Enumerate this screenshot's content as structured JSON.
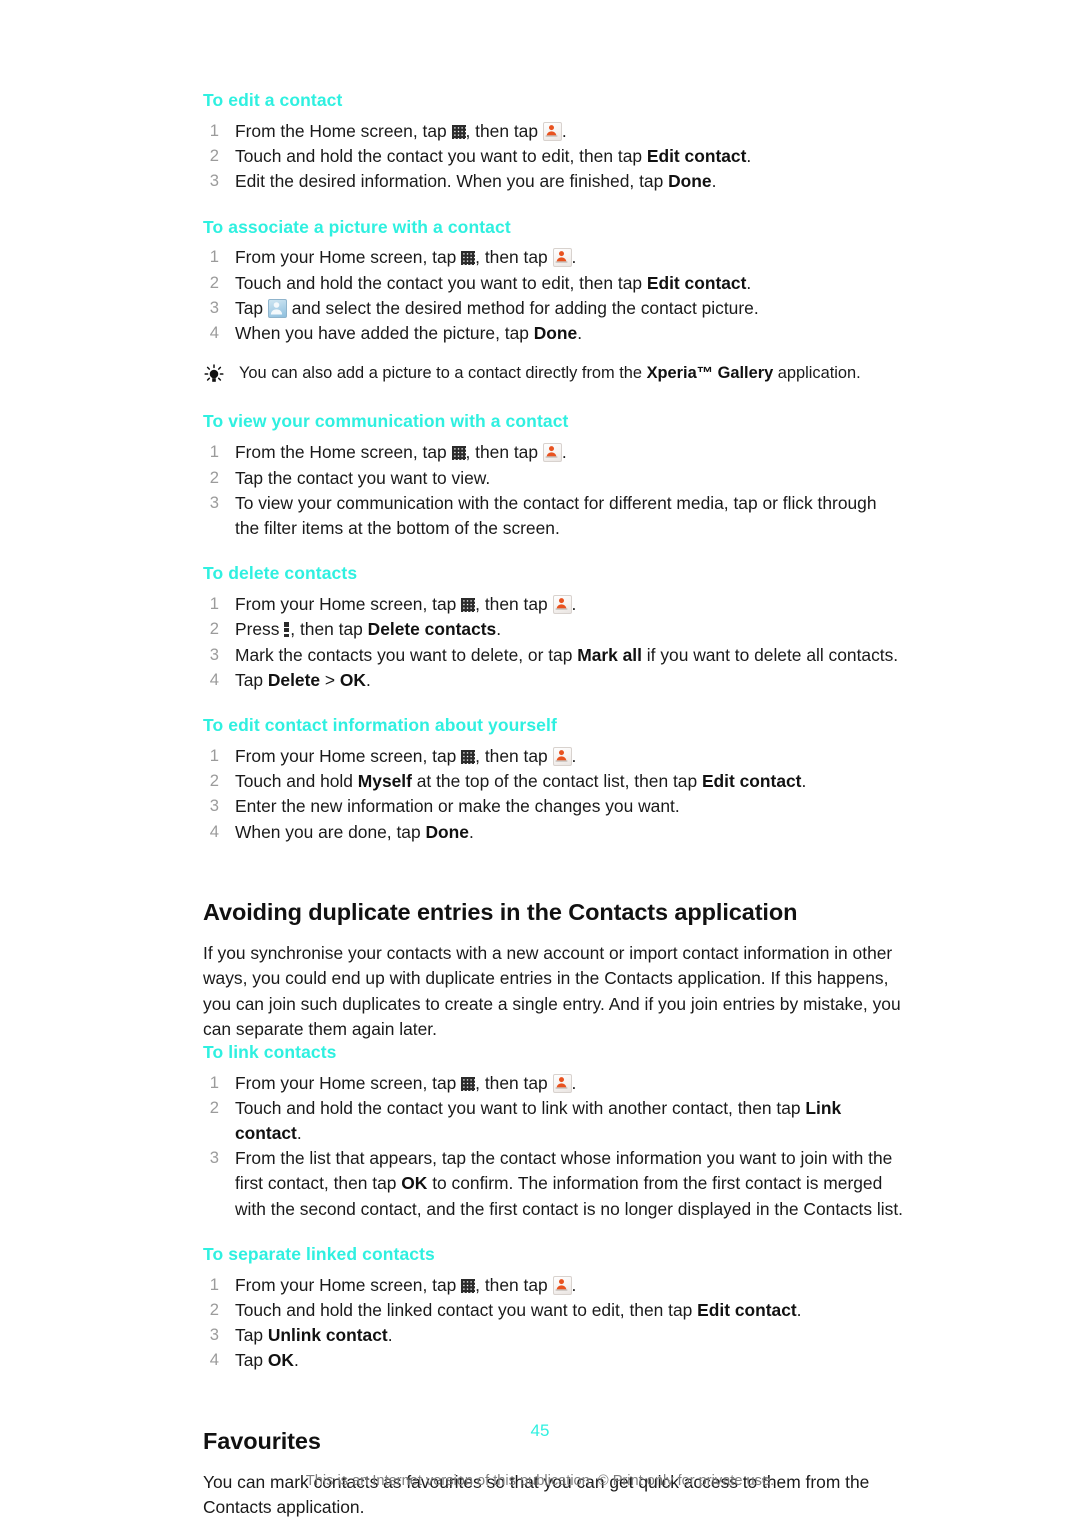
{
  "document": {
    "page_number": "45",
    "footer_note": "This is an Internet version of this publication. © Print only for private use.",
    "heading_color": "#2ff0e0",
    "text_color": "#1a1a1a",
    "number_color": "#9b9b9b"
  },
  "procedures": [
    {
      "id": "edit-a-contact",
      "heading": "To edit a contact",
      "steps": [
        {
          "num": "1",
          "parts": [
            {
              "t": "text",
              "v": "From the Home screen, tap "
            },
            {
              "t": "icon",
              "v": "app-grid-icon"
            },
            {
              "t": "text",
              "v": ", then tap "
            },
            {
              "t": "icon",
              "v": "contacts-icon"
            },
            {
              "t": "text",
              "v": "."
            }
          ]
        },
        {
          "num": "2",
          "parts": [
            {
              "t": "text",
              "v": "Touch and hold the contact you want to edit, then tap "
            },
            {
              "t": "bold",
              "v": "Edit contact"
            },
            {
              "t": "text",
              "v": "."
            }
          ]
        },
        {
          "num": "3",
          "parts": [
            {
              "t": "text",
              "v": "Edit the desired information. When you are finished, tap "
            },
            {
              "t": "bold",
              "v": "Done"
            },
            {
              "t": "text",
              "v": "."
            }
          ]
        }
      ]
    },
    {
      "id": "associate-a-picture-with-a-contact",
      "heading": "To associate a picture with a contact",
      "steps": [
        {
          "num": "1",
          "parts": [
            {
              "t": "text",
              "v": "From your Home screen, tap "
            },
            {
              "t": "icon",
              "v": "app-grid-icon"
            },
            {
              "t": "text",
              "v": ", then tap "
            },
            {
              "t": "icon",
              "v": "contacts-icon"
            },
            {
              "t": "text",
              "v": "."
            }
          ]
        },
        {
          "num": "2",
          "parts": [
            {
              "t": "text",
              "v": "Touch and hold the contact you want to edit, then tap "
            },
            {
              "t": "bold",
              "v": "Edit contact"
            },
            {
              "t": "text",
              "v": "."
            }
          ]
        },
        {
          "num": "3",
          "parts": [
            {
              "t": "text",
              "v": "Tap "
            },
            {
              "t": "icon",
              "v": "contact-picture-icon"
            },
            {
              "t": "text",
              "v": " and select the desired method for adding the contact picture."
            }
          ]
        },
        {
          "num": "4",
          "parts": [
            {
              "t": "text",
              "v": "When you have added the picture, tap "
            },
            {
              "t": "bold",
              "v": "Done"
            },
            {
              "t": "text",
              "v": "."
            }
          ]
        }
      ],
      "tip": {
        "icon": "lightbulb-tip-icon",
        "parts": [
          {
            "t": "text",
            "v": "You can also add a picture to a contact directly from the "
          },
          {
            "t": "bold",
            "v": "Xperia™ Gallery"
          },
          {
            "t": "text",
            "v": " application."
          }
        ]
      }
    },
    {
      "id": "view-your-communication-with-a-contact",
      "heading": "To view your communication with a contact",
      "steps": [
        {
          "num": "1",
          "parts": [
            {
              "t": "text",
              "v": "From the Home screen, tap "
            },
            {
              "t": "icon",
              "v": "app-grid-icon"
            },
            {
              "t": "text",
              "v": ", then tap "
            },
            {
              "t": "icon",
              "v": "contacts-icon"
            },
            {
              "t": "text",
              "v": "."
            }
          ]
        },
        {
          "num": "2",
          "parts": [
            {
              "t": "text",
              "v": "Tap the contact you want to view."
            }
          ]
        },
        {
          "num": "3",
          "parts": [
            {
              "t": "text",
              "v": "To view your communication with the contact for different media, tap or flick through the filter items at the bottom of the screen."
            }
          ]
        }
      ]
    },
    {
      "id": "delete-contacts",
      "heading": "To delete contacts",
      "steps": [
        {
          "num": "1",
          "parts": [
            {
              "t": "text",
              "v": "From your Home screen, tap "
            },
            {
              "t": "icon",
              "v": "app-grid-icon"
            },
            {
              "t": "text",
              "v": ", then tap "
            },
            {
              "t": "icon",
              "v": "contacts-icon"
            },
            {
              "t": "text",
              "v": "."
            }
          ]
        },
        {
          "num": "2",
          "parts": [
            {
              "t": "text",
              "v": "Press "
            },
            {
              "t": "icon",
              "v": "overflow-menu-icon"
            },
            {
              "t": "text",
              "v": ", then tap "
            },
            {
              "t": "bold",
              "v": "Delete contacts"
            },
            {
              "t": "text",
              "v": "."
            }
          ]
        },
        {
          "num": "3",
          "parts": [
            {
              "t": "text",
              "v": "Mark the contacts you want to delete, or tap "
            },
            {
              "t": "bold",
              "v": "Mark all"
            },
            {
              "t": "text",
              "v": " if you want to delete all contacts."
            }
          ]
        },
        {
          "num": "4",
          "parts": [
            {
              "t": "text",
              "v": "Tap "
            },
            {
              "t": "bold",
              "v": "Delete"
            },
            {
              "t": "text",
              "v": " > "
            },
            {
              "t": "bold",
              "v": "OK"
            },
            {
              "t": "text",
              "v": "."
            }
          ]
        }
      ]
    },
    {
      "id": "edit-contact-information-about-yourself",
      "heading": "To edit contact information about yourself",
      "steps": [
        {
          "num": "1",
          "parts": [
            {
              "t": "text",
              "v": "From your Home screen, tap "
            },
            {
              "t": "icon",
              "v": "app-grid-icon"
            },
            {
              "t": "text",
              "v": ", then tap "
            },
            {
              "t": "icon",
              "v": "contacts-icon"
            },
            {
              "t": "text",
              "v": "."
            }
          ]
        },
        {
          "num": "2",
          "parts": [
            {
              "t": "text",
              "v": "Touch and hold "
            },
            {
              "t": "bold",
              "v": "Myself"
            },
            {
              "t": "text",
              "v": " at the top of the contact list, then tap "
            },
            {
              "t": "bold",
              "v": "Edit contact"
            },
            {
              "t": "text",
              "v": "."
            }
          ]
        },
        {
          "num": "3",
          "parts": [
            {
              "t": "text",
              "v": "Enter the new information or make the changes you want."
            }
          ]
        },
        {
          "num": "4",
          "parts": [
            {
              "t": "text",
              "v": "When you are done, tap "
            },
            {
              "t": "bold",
              "v": "Done"
            },
            {
              "t": "text",
              "v": "."
            }
          ]
        }
      ]
    }
  ],
  "sections": [
    {
      "id": "avoiding-duplicate-entries",
      "heading": "Avoiding duplicate entries in the Contacts application",
      "body": "If you synchronise your contacts with a new account or import contact information in other ways, you could end up with duplicate entries in the Contacts application. If this happens, you can join such duplicates to create a single entry. And if you join entries by mistake, you can separate them again later.",
      "procedures": [
        {
          "id": "link-contacts",
          "heading": "To link contacts",
          "steps": [
            {
              "num": "1",
              "parts": [
                {
                  "t": "text",
                  "v": "From your Home screen, tap "
                },
                {
                  "t": "icon",
                  "v": "app-grid-icon"
                },
                {
                  "t": "text",
                  "v": ", then tap "
                },
                {
                  "t": "icon",
                  "v": "contacts-icon"
                },
                {
                  "t": "text",
                  "v": "."
                }
              ]
            },
            {
              "num": "2",
              "parts": [
                {
                  "t": "text",
                  "v": "Touch and hold the contact you want to link with another contact, then tap "
                },
                {
                  "t": "bold",
                  "v": "Link contact"
                },
                {
                  "t": "text",
                  "v": "."
                }
              ]
            },
            {
              "num": "3",
              "parts": [
                {
                  "t": "text",
                  "v": "From the list that appears, tap the contact whose information you want to join with the first contact, then tap "
                },
                {
                  "t": "bold",
                  "v": "OK"
                },
                {
                  "t": "text",
                  "v": " to confirm. The information from the first contact is merged with the second contact, and the first contact is no longer displayed in the Contacts list."
                }
              ]
            }
          ]
        },
        {
          "id": "separate-linked-contacts",
          "heading": "To separate linked contacts",
          "steps": [
            {
              "num": "1",
              "parts": [
                {
                  "t": "text",
                  "v": "From your Home screen, tap "
                },
                {
                  "t": "icon",
                  "v": "app-grid-icon"
                },
                {
                  "t": "text",
                  "v": ", then tap "
                },
                {
                  "t": "icon",
                  "v": "contacts-icon"
                },
                {
                  "t": "text",
                  "v": "."
                }
              ]
            },
            {
              "num": "2",
              "parts": [
                {
                  "t": "text",
                  "v": "Touch and hold the linked contact you want to edit, then tap "
                },
                {
                  "t": "bold",
                  "v": "Edit contact"
                },
                {
                  "t": "text",
                  "v": "."
                }
              ]
            },
            {
              "num": "3",
              "parts": [
                {
                  "t": "text",
                  "v": "Tap "
                },
                {
                  "t": "bold",
                  "v": "Unlink contact"
                },
                {
                  "t": "text",
                  "v": "."
                }
              ]
            },
            {
              "num": "4",
              "parts": [
                {
                  "t": "text",
                  "v": "Tap "
                },
                {
                  "t": "bold",
                  "v": "OK"
                },
                {
                  "t": "text",
                  "v": "."
                }
              ]
            }
          ]
        }
      ]
    },
    {
      "id": "favourites",
      "heading": "Favourites",
      "body": "You can mark contacts as favourites so that you can get quick access to them from the Contacts application.",
      "procedures": []
    }
  ]
}
